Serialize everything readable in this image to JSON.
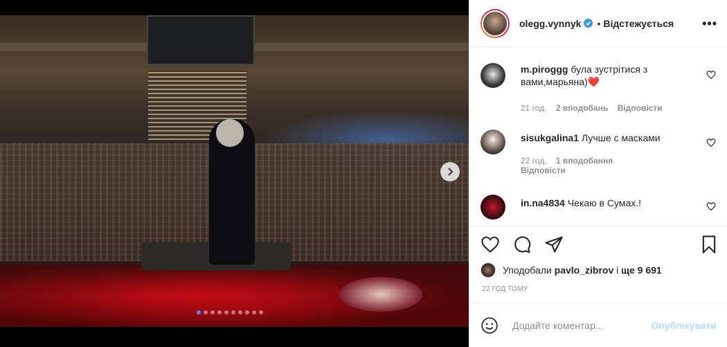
{
  "post": {
    "author": "olegg.vynnyk",
    "verified": true,
    "separator": "•",
    "follow_status": "Відстежується",
    "more_label": "•••"
  },
  "comments": [
    {
      "user": "m.piroggg",
      "text": "була зустрітися з вами,марьяна)",
      "emoji": "❤️",
      "time": "21 год.",
      "likes": "2 вподобань",
      "reply": "Відповісти"
    },
    {
      "user": "sisukgalina1",
      "text": "Лучше с масками",
      "time": "22 год.",
      "likes": "1 вподобання",
      "reply": "Відповісти"
    },
    {
      "user": "in.na4834",
      "text": "Чекаю в Сумах.!"
    }
  ],
  "likes": {
    "prefix": "Уподобали",
    "user": "pavlo_zibrov",
    "middle": "і",
    "count": "ще 9 691"
  },
  "timestamp": "22 ГОД ТОМУ",
  "add_comment": {
    "placeholder": "Додайте коментар...",
    "publish_label": "Опублікувати"
  },
  "carousel": {
    "total": 10,
    "active": 1
  },
  "colors": {
    "accent": "#3897f0",
    "publish_disabled": "#b3dbff",
    "heart": "#ed4956"
  }
}
